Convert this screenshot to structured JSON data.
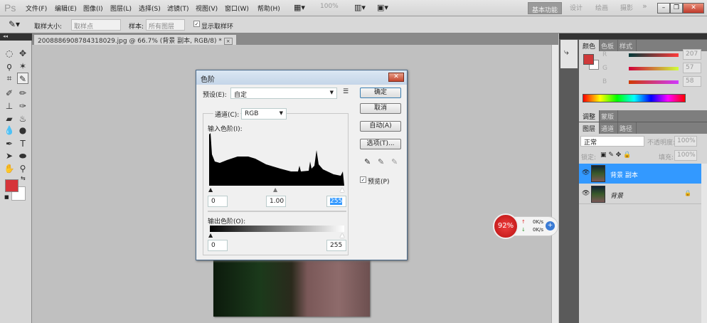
{
  "app": {
    "logo": "Ps",
    "menus": [
      "文件(F)",
      "编辑(E)",
      "图像(I)",
      "图层(L)",
      "选择(S)",
      "滤镜(T)",
      "视图(V)",
      "窗口(W)",
      "帮助(H)"
    ],
    "zoom": "100%",
    "workspaces": {
      "active": "基本功能",
      "others": [
        "设计",
        "绘画",
        "摄影"
      ],
      "more": "»"
    }
  },
  "options": {
    "sample_size_label": "取样大小:",
    "sample_size_value": "取样点",
    "sample_label": "样本:",
    "sample_value": "所有图层",
    "show_ring_label": "显示取样环",
    "show_ring_checked": true
  },
  "document": {
    "tab_title": "2008886908784318029.jpg @ 66.7% (背景 副本, RGB/8) *",
    "close": "×"
  },
  "levels_dialog": {
    "title": "色阶",
    "preset_label": "预设(E):",
    "preset_value": "自定",
    "channel_label": "通道(C):",
    "channel_value": "RGB",
    "input_label": "输入色阶(I):",
    "input_black": "0",
    "input_gamma": "1.00",
    "input_white": "255",
    "output_label": "输出色阶(O):",
    "output_black": "0",
    "output_white": "255",
    "buttons": {
      "ok": "确定",
      "cancel": "取消",
      "auto": "自动(A)",
      "options": "选项(T)..."
    },
    "preview_label": "预览(P)",
    "preview_checked": true
  },
  "net_widget": {
    "percent": "92%",
    "up": "0K/s",
    "down": "0K/s"
  },
  "color_panel": {
    "tabs": [
      "颜色",
      "色板",
      "样式"
    ],
    "channels": [
      {
        "label": "R",
        "value": "207"
      },
      {
        "label": "G",
        "value": "57"
      },
      {
        "label": "B",
        "value": "58"
      }
    ],
    "foreground": "#cf393a"
  },
  "adjust_panel": {
    "tabs": [
      "调整",
      "蒙版"
    ]
  },
  "layers_panel": {
    "tabs": [
      "图层",
      "通道",
      "路径"
    ],
    "blend_mode": "正常",
    "opacity_label": "不透明度:",
    "opacity": "100%",
    "lock_label": "锁定:",
    "fill_label": "填充:",
    "fill": "100%",
    "layers": [
      {
        "name": "背景 副本",
        "selected": true
      },
      {
        "name": "背景",
        "locked": true
      }
    ]
  }
}
